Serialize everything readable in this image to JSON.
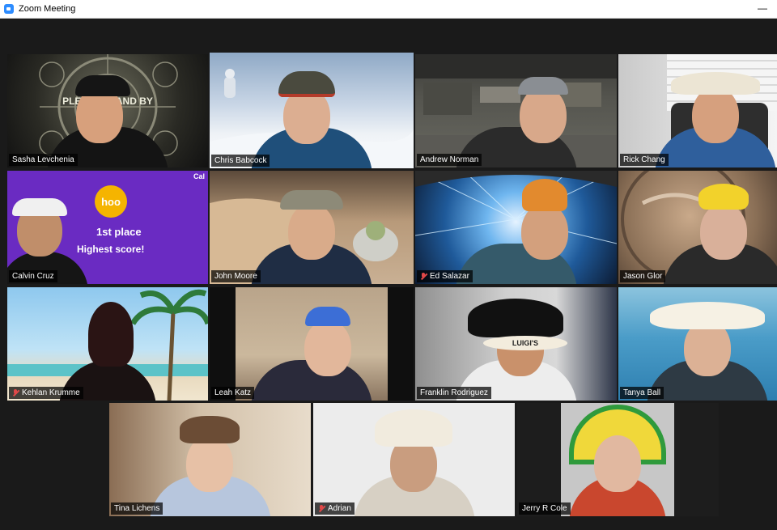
{
  "window": {
    "title": "Zoom Meeting",
    "minimize": "—"
  },
  "participants": [
    {
      "name": "Sasha Levchenia",
      "muted": false,
      "active": false
    },
    {
      "name": "Chris Babcock",
      "muted": false,
      "active": true
    },
    {
      "name": "Andrew Norman",
      "muted": false,
      "active": false
    },
    {
      "name": "Rick Chang",
      "muted": false,
      "active": false
    },
    {
      "name": "Calvin Cruz",
      "muted": false,
      "active": false,
      "overlay": {
        "brand": "hoo",
        "place": "1st place",
        "score": "Highest score!",
        "corner": "Cal"
      }
    },
    {
      "name": "John Moore",
      "muted": false,
      "active": false
    },
    {
      "name": "Ed Salazar",
      "muted": true,
      "active": false
    },
    {
      "name": "Jason Glor",
      "muted": false,
      "active": false
    },
    {
      "name": "Kehlan Krumme",
      "muted": true,
      "active": false
    },
    {
      "name": "Leah Katz",
      "muted": false,
      "active": false
    },
    {
      "name": "Franklin Rodriguez",
      "muted": false,
      "active": false,
      "hat_text": "LUIGI'S"
    },
    {
      "name": "Tanya Ball",
      "muted": false,
      "active": false
    },
    {
      "name": "Tina Lichens",
      "muted": false,
      "active": false
    },
    {
      "name": "Adrian",
      "muted": true,
      "active": false
    },
    {
      "name": "Jerry R Cole",
      "muted": false,
      "active": false
    }
  ],
  "backdrop_text": {
    "sasha": "PLEASE STAND BY"
  },
  "colors": {
    "active_border": "#d6e35a",
    "muted_icon": "#e04848",
    "hoo_purple": "#6a2bc2",
    "hoo_gold": "#f5b400"
  }
}
